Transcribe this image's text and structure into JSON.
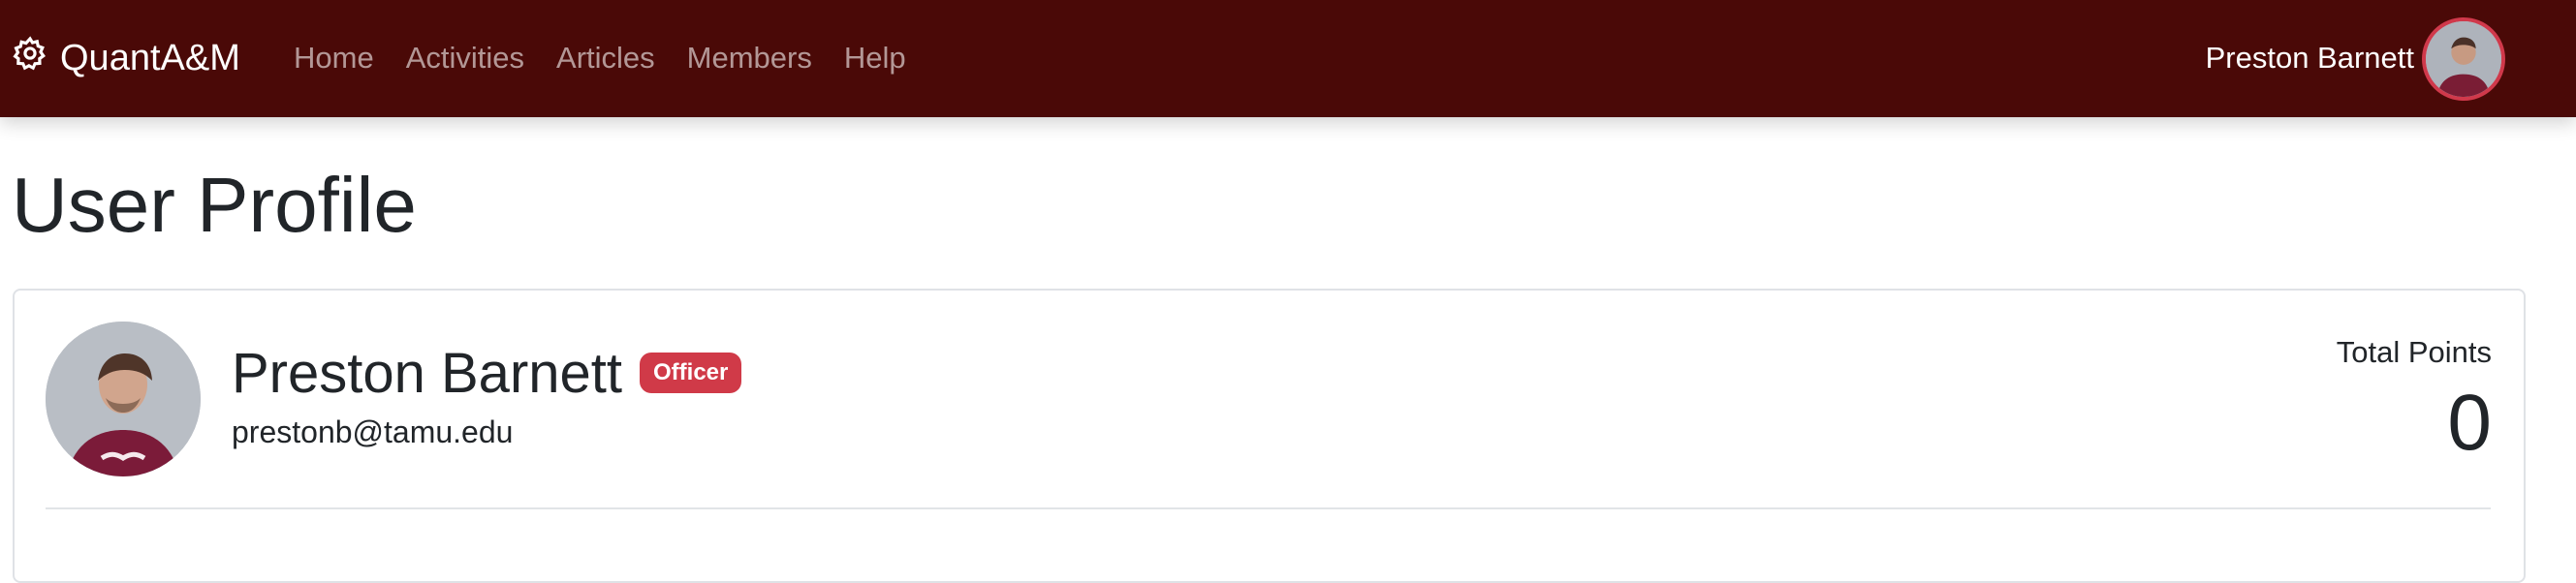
{
  "navbar": {
    "brand_icon": "gear-icon",
    "brand_label": "QuantA&M",
    "links": [
      "Home",
      "Activities",
      "Articles",
      "Members",
      "Help"
    ],
    "user_name": "Preston Barnett",
    "avatar_icon": "user-avatar",
    "bg_color": "#4a0907"
  },
  "page": {
    "title": "User Profile"
  },
  "profile": {
    "name": "Preston Barnett",
    "badge": "Officer",
    "badge_color": "#d03a48",
    "email": "prestonb@tamu.edu",
    "points_label": "Total Points",
    "points_value": "0"
  }
}
